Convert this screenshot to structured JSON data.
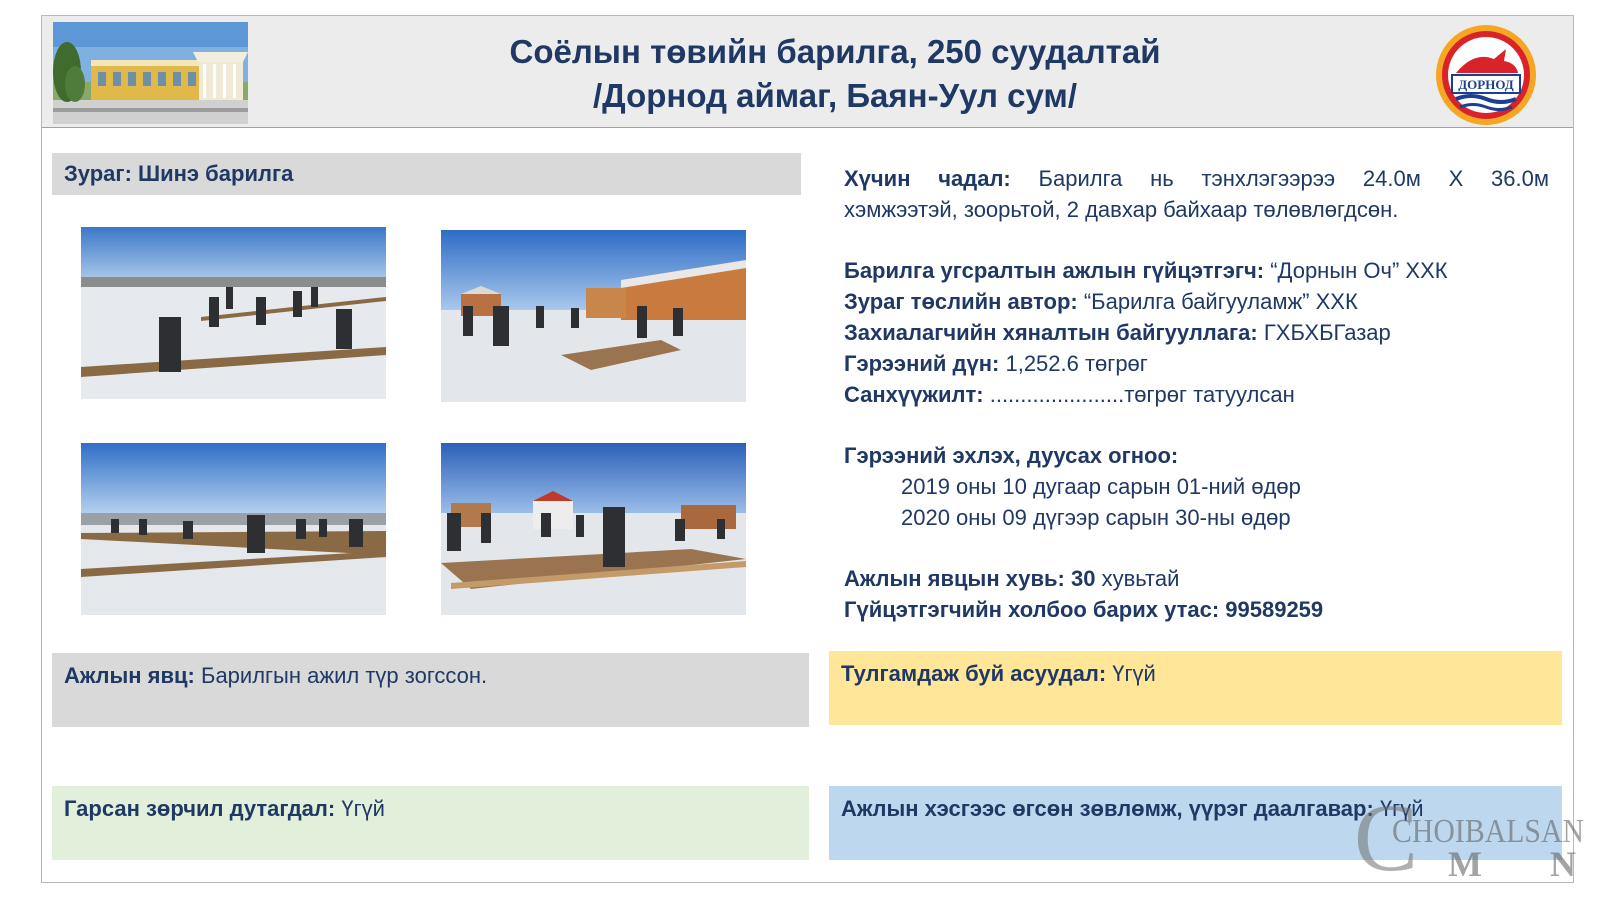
{
  "header": {
    "title_line1": "Соёлын төвийн барилга, 250 суудалтай",
    "title_line2": "/Дорнод аймаг, Баян-Уул сум/",
    "logo_text": "ДОРНОД"
  },
  "photos": {
    "label": "Зураг: Шинэ барилга"
  },
  "info": {
    "capacity_label": "Хүчин чадал:",
    "capacity_text_1": "Барилга нь тэнхлэгээрээ 24.0м Х 36.0м",
    "capacity_text_2": "хэмжээтэй, зоорьтой, 2 давхар байхаар төлөвлөгдсөн.",
    "contractor_label": "Барилга угсралтын ажлын гүйцэтгэгч:",
    "contractor_value": "“Дорнын Оч” ХХК",
    "designer_label": "Зураг төслийн автор:",
    "designer_value": "“Барилга байгууламж” ХХК",
    "supervisor_label": "Захиалагчийн хяналтын байгууллага:",
    "supervisor_value": "ГХБХБГазар",
    "contract_label": "Гэрээний дүн:",
    "contract_value": "1,252.6 төгрөг",
    "funding_label": "Санхүүжилт:",
    "funding_value": "......................төгрөг татуулсан",
    "dates_label": "Гэрээний эхлэх, дуусах огноо:",
    "date_start": "2019 оны 10 дугаар сарын 01-ний өдөр",
    "date_end": "2020 оны 09 дүгээр сарын 30-ны өдөр",
    "progress_label": "Ажлын явцын хувь:",
    "progress_value": "30",
    "progress_suffix": "хувьтай",
    "phone_label": "Гүйцэтгэгчийн холбоо барих утас:",
    "phone_value": "99589259"
  },
  "boxes": {
    "progress_label": "Ажлын явц:",
    "progress_text": "Барилгын ажил түр зогссон.",
    "issue_label": "Тулгамдаж буй асуудал:",
    "issue_text": "Үгүй",
    "violation_label": "Гарсан зөрчил дутагдал:",
    "violation_text": "Үгүй",
    "advice_label": "Ажлын хэсгээс өгсөн зөвлөмж, үүрэг даалгавар:",
    "advice_text": "Үгүй"
  },
  "watermark": {
    "line1": "CHOIBALSAN",
    "line2": "MN"
  },
  "colors": {
    "text": "#1f3864",
    "header_bg": "#ececec",
    "gray_box": "#d9d9d9",
    "yellow_box": "#ffe699",
    "green_box": "#e2efda",
    "blue_box": "#bdd7ee"
  }
}
